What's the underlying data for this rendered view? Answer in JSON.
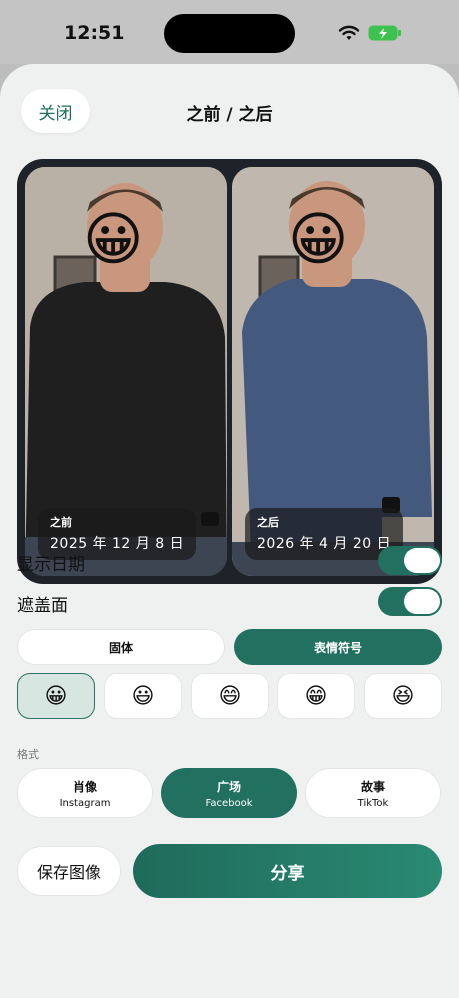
{
  "status_bar": {
    "time": "12:51"
  },
  "header": {
    "close_label": "关闭",
    "title": "之前 / 之后"
  },
  "photos": {
    "before": {
      "label": "之前",
      "date": "2025 年 12 月 8 日",
      "shirt_color": "#1f1f1f"
    },
    "after": {
      "label": "之后",
      "date": "2026 年 4 月 20 日",
      "shirt_color": "#44597e"
    }
  },
  "toggles": [
    {
      "label": "显示日期",
      "on": true
    },
    {
      "label": "遮盖面",
      "on": true
    }
  ],
  "mask_style": {
    "options": [
      "固体",
      "表情符号"
    ],
    "selected": "表情符号"
  },
  "emojis": {
    "items": [
      "😀",
      "😃",
      "😄",
      "😁",
      "😆"
    ],
    "selected_index": 0
  },
  "format": {
    "section_label": "格式",
    "options": [
      {
        "title": "肖像",
        "subtitle": "Instagram"
      },
      {
        "title": "广场",
        "subtitle": "Facebook"
      },
      {
        "title": "故事",
        "subtitle": "TikTok"
      }
    ],
    "selected_index": 1
  },
  "actions": {
    "save_label": "保存图像",
    "share_label": "分享"
  },
  "colors": {
    "accent": "#22705f",
    "sheet_bg": "#eef1ef"
  }
}
